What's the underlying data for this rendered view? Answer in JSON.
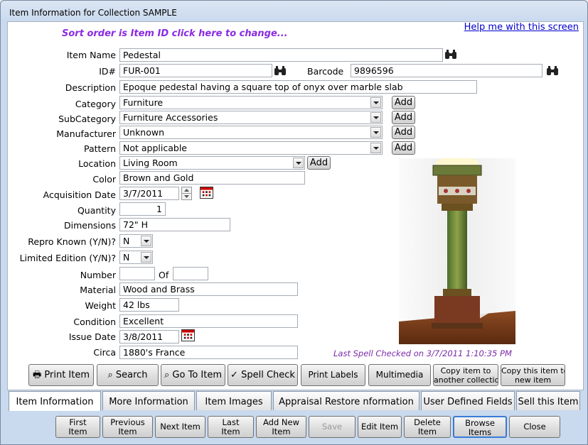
{
  "window": {
    "title": "Item Information for Collection SAMPLE"
  },
  "header": {
    "sort_text": "Sort order is Item ID click here to change...",
    "help_link": "Help me with this screen"
  },
  "fields": {
    "item_name_label": "Item Name",
    "item_name": "Pedestal",
    "id_label": "ID#",
    "id": "FUR-001",
    "barcode_label": "Barcode",
    "barcode": "9896596",
    "description_label": "Description",
    "description": "Epoque  pedestal having a square top of onyx over marble slab",
    "category_label": "Category",
    "category": "Furniture",
    "subcategory_label": "SubCategory",
    "subcategory": "Furniture Accessories",
    "manufacturer_label": "Manufacturer",
    "manufacturer": "Unknown",
    "pattern_label": "Pattern",
    "pattern": "Not applicable",
    "location_label": "Location",
    "location": "Living Room",
    "color_label": "Color",
    "color": "Brown and Gold",
    "acq_date_label": "Acquisition Date",
    "acq_date": "3/7/2011",
    "quantity_label": "Quantity",
    "quantity": "1",
    "dimensions_label": "Dimensions",
    "dimensions": "72\" H",
    "repro_label": "Repro Known (Y/N)?",
    "repro": "N",
    "limited_label": "Limited Edition (Y/N)?",
    "limited": "N",
    "number_label": "Number",
    "number": "",
    "of_label": "Of",
    "of": "",
    "material_label": "Material",
    "material": "Wood and Brass",
    "weight_label": "Weight",
    "weight": "42 lbs",
    "condition_label": "Condition",
    "condition": "Excellent",
    "issue_date_label": "Issue Date",
    "issue_date": "3/8/2011",
    "circa_label": "Circa",
    "circa": "1880's France"
  },
  "add_label": "Add",
  "spell_status": "Last Spell Checked on  3/7/2011 1:10:35 PM",
  "actions": {
    "print_item": "Print Item",
    "search": "Search",
    "goto_item": "Go To Item",
    "spell_check": "Spell Check",
    "print_labels": "Print Labels",
    "multimedia": "Multimedia",
    "copy_other_1": "Copy item to",
    "copy_other_2": "another collection",
    "copy_new_1": "Copy this item to a",
    "copy_new_2": "new item"
  },
  "tabs": [
    "Item Information",
    "More Information",
    "Item Images",
    "Appraisal Restore nformation",
    "User Defined Fields",
    "Sell this Item"
  ],
  "nav": {
    "first_1": "First",
    "first_2": "Item",
    "prev_1": "Previous",
    "prev_2": "Item",
    "next": "Next Item",
    "last_1": "Last",
    "last_2": "Item",
    "addnew_1": "Add New",
    "addnew_2": "Item",
    "save": "Save",
    "edit": "Edit Item",
    "delete_1": "Delete",
    "delete_2": "Item",
    "browse_1": "Browse",
    "browse_2": "Items",
    "close": "Close"
  }
}
